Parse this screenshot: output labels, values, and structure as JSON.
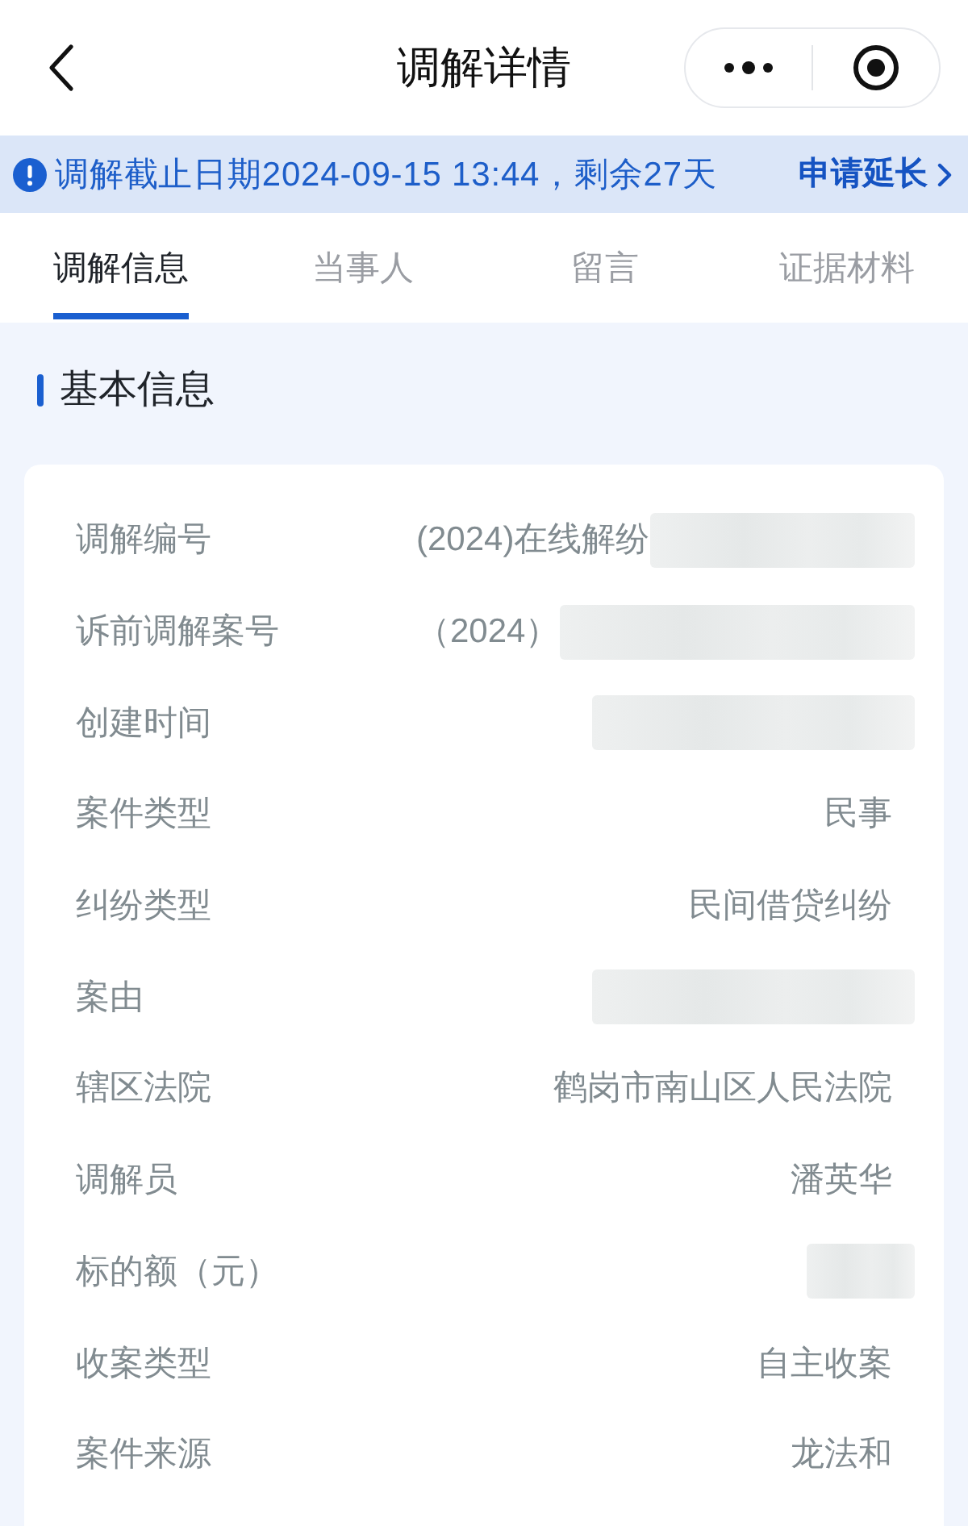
{
  "nav_bar": {
    "title": "调解详情"
  },
  "deadline_notice": {
    "text": "调解截止日期2024-09-15 13:44，剩余27天",
    "action": "申请延长"
  },
  "tabs": [
    {
      "label": "调解信息",
      "selected": true
    },
    {
      "label": "当事人",
      "selected": false
    },
    {
      "label": "留言",
      "selected": false
    },
    {
      "label": "证据材料",
      "selected": false
    }
  ],
  "basic_info": {
    "title": "基本信息",
    "fields": [
      {
        "label": "调解编号",
        "value": "(2024)在线解纷",
        "redacted": true
      },
      {
        "label": "诉前调解案号",
        "value": "（2024）",
        "redacted": true
      },
      {
        "label": "创建时间",
        "redacted": true
      },
      {
        "label": "案件类型",
        "value": "民事",
        "redacted": false
      },
      {
        "label": "纠纷类型",
        "value": "民间借贷纠纷",
        "redacted": false
      },
      {
        "label": "案由",
        "redacted": true
      },
      {
        "label": "辖区法院",
        "value": "鹤岗市南山区人民法院",
        "redacted": false
      },
      {
        "label": "调解员",
        "value": "潘英华",
        "redacted": false
      },
      {
        "label": "标的额（元）",
        "redacted": true
      },
      {
        "label": "收案类型",
        "value": "自主收案",
        "redacted": false
      },
      {
        "label": "案件来源",
        "value": "龙法和",
        "redacted": false
      }
    ]
  }
}
